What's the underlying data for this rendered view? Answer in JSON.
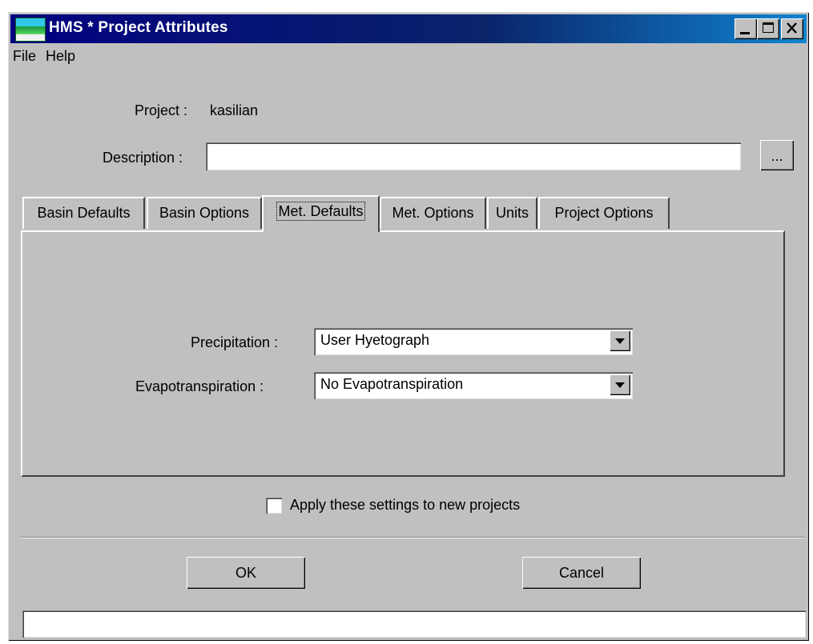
{
  "window": {
    "title": "HMS * Project Attributes",
    "controls": {
      "minimize": "minimize-icon",
      "maximize": "maximize-icon",
      "close": "close-icon"
    }
  },
  "menu": [
    {
      "label": "File"
    },
    {
      "label": "Help"
    }
  ],
  "project": {
    "label": "Project :",
    "value": "kasilian"
  },
  "description": {
    "label": "Description :",
    "value": "",
    "browse_label": "..."
  },
  "tabs": [
    {
      "label": "Basin Defaults",
      "active": false
    },
    {
      "label": "Basin Options",
      "active": false
    },
    {
      "label": "Met. Defaults",
      "active": true
    },
    {
      "label": "Met. Options",
      "active": false
    },
    {
      "label": "Units",
      "active": false
    },
    {
      "label": "Project Options",
      "active": false
    }
  ],
  "met_defaults": {
    "precipitation": {
      "label": "Precipitation :",
      "value": "User Hyetograph"
    },
    "evapotranspiration": {
      "label": "Evapotranspiration :",
      "value": "No Evapotranspiration"
    }
  },
  "apply_checkbox": {
    "label": "Apply these settings to new projects",
    "checked": false
  },
  "buttons": {
    "ok": "OK",
    "cancel": "Cancel"
  },
  "status_bar": {
    "text": ""
  },
  "colors": {
    "titlebar": "#000080",
    "face": "#c0c0c0"
  }
}
